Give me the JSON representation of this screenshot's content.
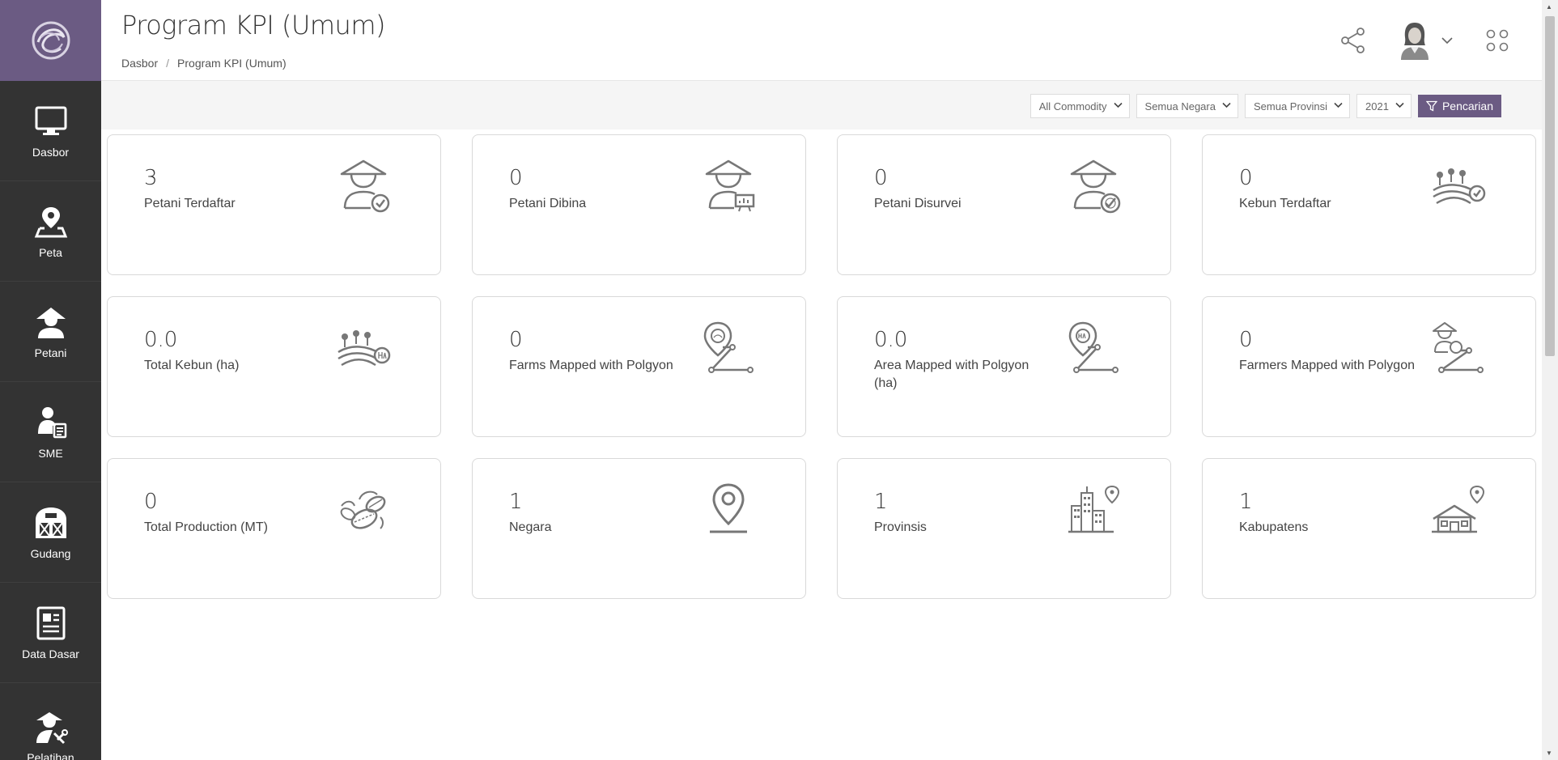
{
  "header": {
    "title": "Program KPI (Umum)",
    "breadcrumb": [
      "Dasbor",
      "Program KPI (Umum)"
    ],
    "breadcrumb_sep": "/"
  },
  "sidebar": {
    "items": [
      {
        "label": "Dasbor",
        "icon": "monitor-icon"
      },
      {
        "label": "Peta",
        "icon": "map-pin-icon"
      },
      {
        "label": "Petani",
        "icon": "farmer-icon"
      },
      {
        "label": "SME",
        "icon": "sme-icon"
      },
      {
        "label": "Gudang",
        "icon": "warehouse-icon"
      },
      {
        "label": "Data Dasar",
        "icon": "document-icon"
      },
      {
        "label": "Pelatihan",
        "icon": "training-icon"
      }
    ]
  },
  "filters": {
    "commodity": "All Commodity",
    "country": "Semua Negara",
    "province": "Semua Provinsi",
    "year": "2021",
    "search_label": "Pencarian"
  },
  "cards": [
    {
      "value": "3",
      "label": "Petani Terdaftar",
      "icon": "farmer-check-icon"
    },
    {
      "value": "0",
      "label": "Petani Dibina",
      "icon": "farmer-training-icon"
    },
    {
      "value": "0",
      "label": "Petani Disurvei",
      "icon": "farmer-survey-icon"
    },
    {
      "value": "0",
      "label": "Kebun Terdaftar",
      "icon": "farm-check-icon"
    },
    {
      "value": "0.0",
      "label": "Total Kebun (ha)",
      "icon": "farm-ha-icon"
    },
    {
      "value": "0",
      "label": "Farms Mapped with Polgyon",
      "icon": "polygon-farm-icon"
    },
    {
      "value": "0.0",
      "label": "Area Mapped with Polgyon (ha)",
      "icon": "polygon-area-icon"
    },
    {
      "value": "0",
      "label": "Farmers Mapped with Polygon",
      "icon": "polygon-farmer-icon"
    },
    {
      "value": "0",
      "label": "Total Production (MT)",
      "icon": "beans-icon"
    },
    {
      "value": "1",
      "label": "Negara",
      "icon": "location-pin-icon"
    },
    {
      "value": "1",
      "label": "Provinsis",
      "icon": "city-icon"
    },
    {
      "value": "1",
      "label": "Kabupatens",
      "icon": "house-pin-icon"
    }
  ],
  "colors": {
    "sidebar_bg": "#333333",
    "accent": "#6b5b83",
    "icon_gray": "#777777"
  }
}
